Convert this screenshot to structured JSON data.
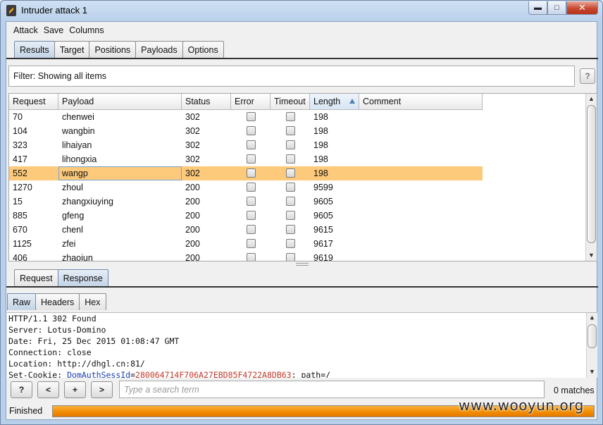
{
  "window": {
    "title": "Intruder attack 1"
  },
  "menu": [
    "Attack",
    "Save",
    "Columns"
  ],
  "top_tabs": [
    {
      "label": "Results",
      "active": true
    },
    {
      "label": "Target",
      "active": false
    },
    {
      "label": "Positions",
      "active": false
    },
    {
      "label": "Payloads",
      "active": false
    },
    {
      "label": "Options",
      "active": false
    }
  ],
  "filter": {
    "text": "Filter: Showing all items",
    "help": "?"
  },
  "table": {
    "columns": [
      "Request",
      "Payload",
      "Status",
      "Error",
      "Timeout",
      "Length",
      "Comment"
    ],
    "sorted_column": "Length",
    "rows": [
      {
        "request": "70",
        "payload": "chenwei",
        "status": "302",
        "length": "198",
        "selected": false
      },
      {
        "request": "104",
        "payload": "wangbin",
        "status": "302",
        "length": "198",
        "selected": false
      },
      {
        "request": "323",
        "payload": "lihaiyan",
        "status": "302",
        "length": "198",
        "selected": false
      },
      {
        "request": "417",
        "payload": "lihongxia",
        "status": "302",
        "length": "198",
        "selected": false
      },
      {
        "request": "552",
        "payload": "wangp",
        "status": "302",
        "length": "198",
        "selected": true
      },
      {
        "request": "1270",
        "payload": "zhoul",
        "status": "200",
        "length": "9599",
        "selected": false
      },
      {
        "request": "15",
        "payload": "zhangxiuying",
        "status": "200",
        "length": "9605",
        "selected": false
      },
      {
        "request": "885",
        "payload": "gfeng",
        "status": "200",
        "length": "9605",
        "selected": false
      },
      {
        "request": "670",
        "payload": "chenl",
        "status": "200",
        "length": "9615",
        "selected": false
      },
      {
        "request": "1125",
        "payload": "zfei",
        "status": "200",
        "length": "9617",
        "selected": false
      },
      {
        "request": "406",
        "payload": "zhaojun",
        "status": "200",
        "length": "9619",
        "selected": false
      }
    ]
  },
  "message_tabs": [
    {
      "label": "Request",
      "active": false
    },
    {
      "label": "Response",
      "active": true
    }
  ],
  "view_tabs": [
    {
      "label": "Raw",
      "active": true
    },
    {
      "label": "Headers",
      "active": false
    },
    {
      "label": "Hex",
      "active": false
    }
  ],
  "response_lines": [
    "HTTP/1.1 302 Found",
    "Server: Lotus-Domino",
    "Date: Fri, 25 Dec 2015 01:08:47 GMT",
    "Connection: close",
    "Location: http://dhgl.cn:81/"
  ],
  "cookie_line": {
    "prefix": "Set-Cookie: ",
    "name": "DomAuthSessId",
    "eq": "=",
    "value": "280064714F706A27EBD85F4722A8DB63",
    "suffix": "; path=/"
  },
  "search": {
    "buttons": [
      "?",
      "<",
      "+",
      ">"
    ],
    "placeholder": "Type a search term",
    "matches": "0 matches"
  },
  "status": {
    "text": "Finished",
    "progress": 1.0
  },
  "watermark": "www.wooyun.org",
  "colors": {
    "selected_row": "#fdc97a",
    "progress": "#f08a00",
    "cookie_name": "#1a3fb5",
    "cookie_value": "#c0392b"
  }
}
